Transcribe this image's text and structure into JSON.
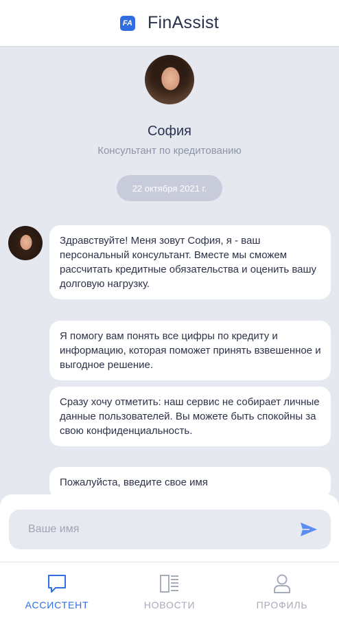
{
  "header": {
    "logo_text": "FA",
    "title": "FinAssist"
  },
  "agent": {
    "name": "София",
    "role": "Консультант по кредитованию"
  },
  "date_label": "22 октября 2021 г.",
  "messages": [
    {
      "text": "Здравствуйте! Меня зовут София, я - ваш персональный консультант. Вместе мы сможем рассчитать кредитные обязательства и оценить вашу долговую нагрузку."
    },
    {
      "text": "Я помогу вам понять все цифры по кредиту и информацию, которая поможет принять взвешенное и выгодное решение."
    },
    {
      "text": "Сразу хочу отметить: наш сервис не собирает личные данные пользователей. Вы можете быть спокойны за свою конфиденциальность."
    },
    {
      "text": "Пожалуйста, введите свое имя"
    }
  ],
  "input": {
    "placeholder": "Ваше имя",
    "value": ""
  },
  "tabs": [
    {
      "label": "АССИСТЕНТ",
      "icon": "chat-bubble-icon",
      "active": true
    },
    {
      "label": "НОВОСТИ",
      "icon": "news-icon",
      "active": false
    },
    {
      "label": "ПРОФИЛЬ",
      "icon": "user-icon",
      "active": false
    }
  ],
  "colors": {
    "accent": "#2f6de1",
    "background": "#e6e8f0",
    "inactive": "#a6abba"
  }
}
